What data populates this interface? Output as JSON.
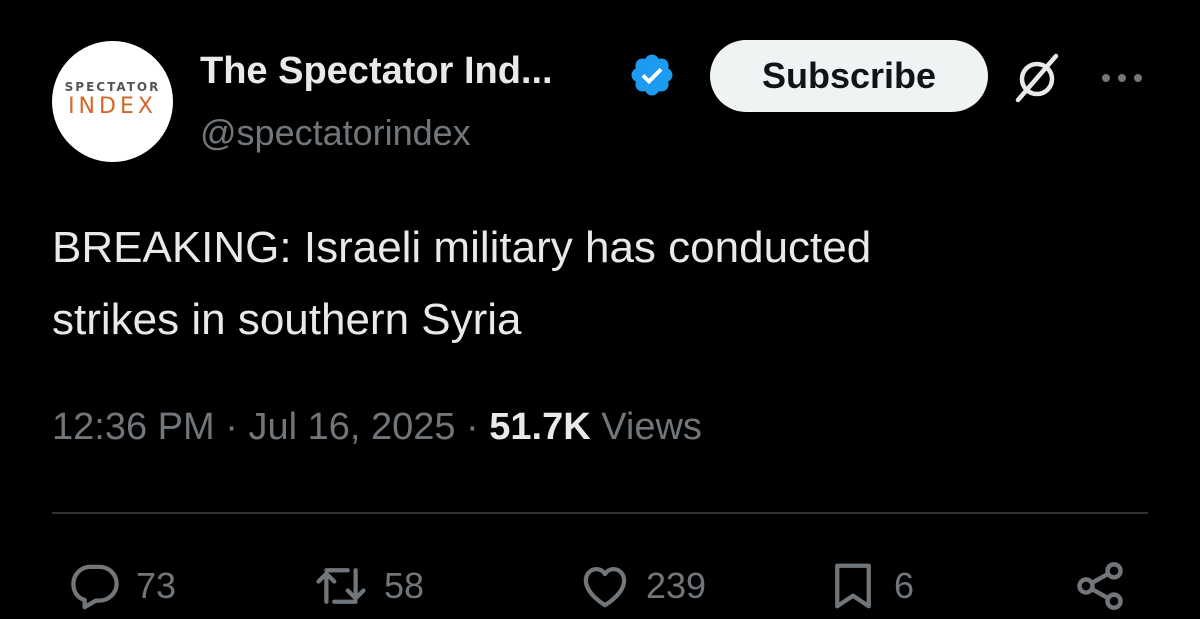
{
  "author": {
    "avatar_logo_top": "SPECTATOR",
    "avatar_logo_bottom": "INDEX",
    "display_name": "The Spectator Ind...",
    "handle": "@spectatorindex",
    "verified_icon": "verified-badge-icon",
    "verified_color": "#1d9bf0"
  },
  "header": {
    "subscribe_label": "Subscribe",
    "grok_icon": "grok-icon",
    "more_icon": "more-options-icon"
  },
  "tweet": {
    "text_line_1": "BREAKING: Israeli military has conducted",
    "text_line_2": "strikes in southern Syria",
    "time": "12:36 PM",
    "separator": " · ",
    "date": "Jul 16, 2025",
    "views_count": "51.7K",
    "views_label": "Views"
  },
  "actions": {
    "reply": {
      "icon": "reply-icon",
      "count": "73"
    },
    "retweet": {
      "icon": "retweet-icon",
      "count": "58"
    },
    "like": {
      "icon": "heart-icon",
      "count": "239"
    },
    "bookmark": {
      "icon": "bookmark-icon",
      "count": "6"
    },
    "share": {
      "icon": "share-icon"
    }
  },
  "colors": {
    "background": "#000000",
    "primary_text": "#e7e9ea",
    "secondary_text": "#71767b",
    "divider": "#2f3336",
    "accent": "#1d9bf0",
    "logo_orange": "#d4662a"
  }
}
